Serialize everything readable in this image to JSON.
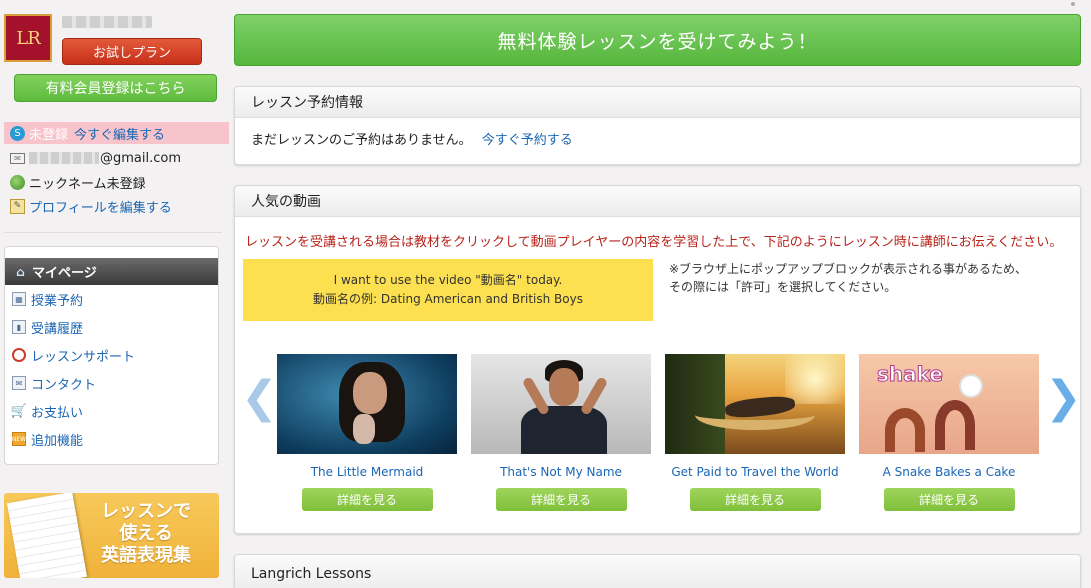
{
  "sidebar": {
    "logo_text": "LR",
    "trial_button": "お試しプラン",
    "member_button": "有料会員登録はこちら",
    "status": {
      "label": "未登録",
      "link": "今すぐ編集する"
    },
    "email_suffix": "@gmail.com",
    "nickname": "ニックネーム未登録",
    "edit_profile": "プロフィールを編集する",
    "mypage": {
      "title": "マイページ",
      "items": [
        {
          "label": "授業予約",
          "icon": "calendar-icon"
        },
        {
          "label": "受講履歴",
          "icon": "chart-icon"
        },
        {
          "label": "レッスンサポート",
          "icon": "lifebuoy-icon"
        },
        {
          "label": "コンタクト",
          "icon": "mail-icon"
        },
        {
          "label": "お支払い",
          "icon": "cart-icon"
        },
        {
          "label": "追加機能",
          "icon": "new-icon"
        }
      ]
    },
    "banner": {
      "line1": "レッスンで",
      "line2": "使える",
      "line3": "英語表現集"
    }
  },
  "main": {
    "cta": "無料体験レッスンを受けてみよう！",
    "reservation": {
      "title": "レッスン予約情報",
      "message": "まだレッスンのご予約はありません。",
      "link": "今すぐ予約する"
    },
    "videos": {
      "title": "人気の動画",
      "notice": "レッスンを受講される場合は教材をクリックして動画プレイヤーの内容を学習した上で、下記のようにレッスン時に講師にお伝えください。",
      "example_line1": "I want to use the video \"動画名\" today.",
      "example_line2": "動画名の例: Dating American and British Boys",
      "popup_line1": "※ブラウザ上にポップアップブロックが表示される事があるため、",
      "popup_line2": "その際には「許可」を選択してください。",
      "items": [
        {
          "title": "The Little Mermaid",
          "button": "詳細を見る"
        },
        {
          "title": "That's Not My Name",
          "button": "詳細を見る"
        },
        {
          "title": "Get Paid to Travel the World",
          "button": "詳細を見る"
        },
        {
          "title": "A Snake Bakes a Cake",
          "button": "詳細を見る",
          "thumb_text": "shake"
        }
      ],
      "prev_arrow": "❮",
      "next_arrow": "❯"
    },
    "langrich": {
      "title": "Langrich Lessons"
    }
  },
  "colors": {
    "accent_green": "#5dbb3d",
    "accent_red": "#c6301a",
    "link_blue": "#1a66b3",
    "notice_red": "#b8231b",
    "highlight_yellow": "#fde04f"
  }
}
